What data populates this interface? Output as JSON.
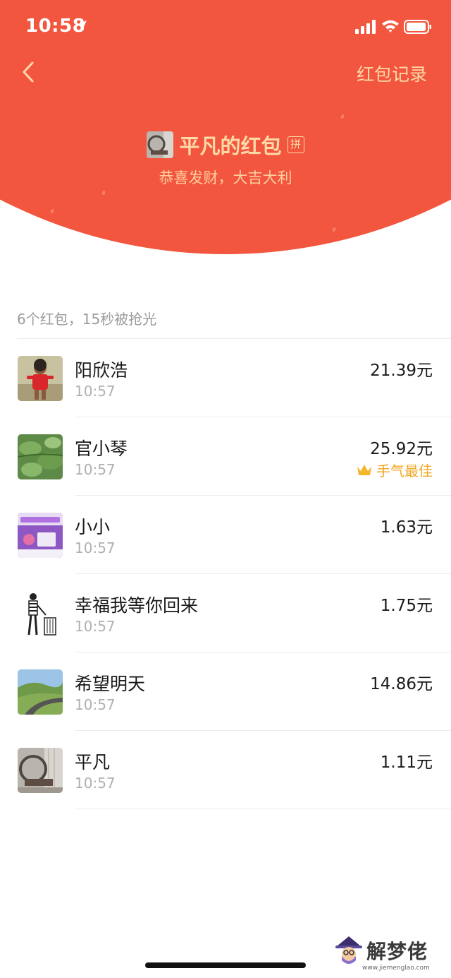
{
  "status": {
    "time": "10:58",
    "icons": [
      "location-arrow-icon",
      "signal-icon",
      "wifi-icon",
      "battery-icon"
    ]
  },
  "nav": {
    "back_icon": "chevron-left-icon",
    "record_label": "红包记录"
  },
  "sender": {
    "name": "平凡的红包",
    "badge": "拼",
    "blessing": "恭喜发财，大吉大利"
  },
  "summary": "6个红包，15秒被抢光",
  "records": [
    {
      "name": "阳欣浩",
      "time": "10:57",
      "amount": "21.39元",
      "best": ""
    },
    {
      "name": "官小琴",
      "time": "10:57",
      "amount": "25.92元",
      "best": "手气最佳"
    },
    {
      "name": "小小",
      "time": "10:57",
      "amount": "1.63元",
      "best": ""
    },
    {
      "name": "幸福我等你回来",
      "time": "10:57",
      "amount": "1.75元",
      "best": ""
    },
    {
      "name": "希望明天",
      "time": "10:57",
      "amount": "14.86元",
      "best": ""
    },
    {
      "name": "平凡",
      "time": "10:57",
      "amount": "1.11元",
      "best": ""
    }
  ],
  "watermark": {
    "text": "解梦佬",
    "url": "www.jiemenglao.com"
  },
  "colors": {
    "header_red": "#f2563f",
    "gold_text": "#ffd9a8",
    "best_orange": "#f0a825"
  }
}
